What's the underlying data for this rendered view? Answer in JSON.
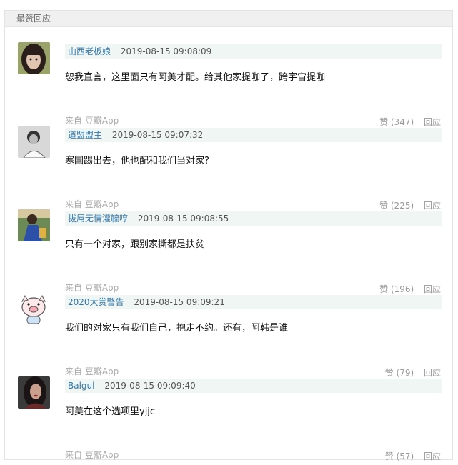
{
  "section": {
    "title": "最赞回应"
  },
  "comments": [
    {
      "author": "山西老板娘",
      "time": "2019-08-15 09:08:09",
      "content": "恕我直言，这里面只有阿美才配。给其他家提咖了，跨宇宙提咖",
      "source": "来自 豆瓣App",
      "likes": "赞 (347)",
      "reply": "回应",
      "avatar_icon": "avatar-girl-dark-hair-icon"
    },
    {
      "author": "道盟盟主",
      "time": "2019-08-15 09:07:32",
      "content": "寒国踢出去，他也配和我们当对家?",
      "source": "来自 豆瓣App",
      "likes": "赞 (225)",
      "reply": "回应",
      "avatar_icon": "avatar-bw-man-icon"
    },
    {
      "author": "拔屌无情灌毓哼",
      "time": "2019-08-15 09:08:55",
      "content": "只有一个对家，跟别家撕都是扶贫",
      "source": "来自 豆瓣App",
      "likes": "赞 (196)",
      "reply": "回应",
      "avatar_icon": "avatar-girl-blue-icon"
    },
    {
      "author": "2020大赏警告",
      "time": "2019-08-15 09:09:21",
      "content": "我们的对家只有我们自己，抱走不约。还有，阿韩是谁",
      "source": "来自 豆瓣App",
      "likes": "赞 (79)",
      "reply": "回应",
      "avatar_icon": "avatar-cartoon-pig-icon"
    },
    {
      "author": "Balgul",
      "time": "2019-08-15 09:09:40",
      "content": "阿美在这个选项里yjjc",
      "source": "来自 豆瓣App",
      "likes": "赞 (57)",
      "reply": "回应",
      "avatar_icon": "avatar-woman-dark-icon"
    }
  ]
}
